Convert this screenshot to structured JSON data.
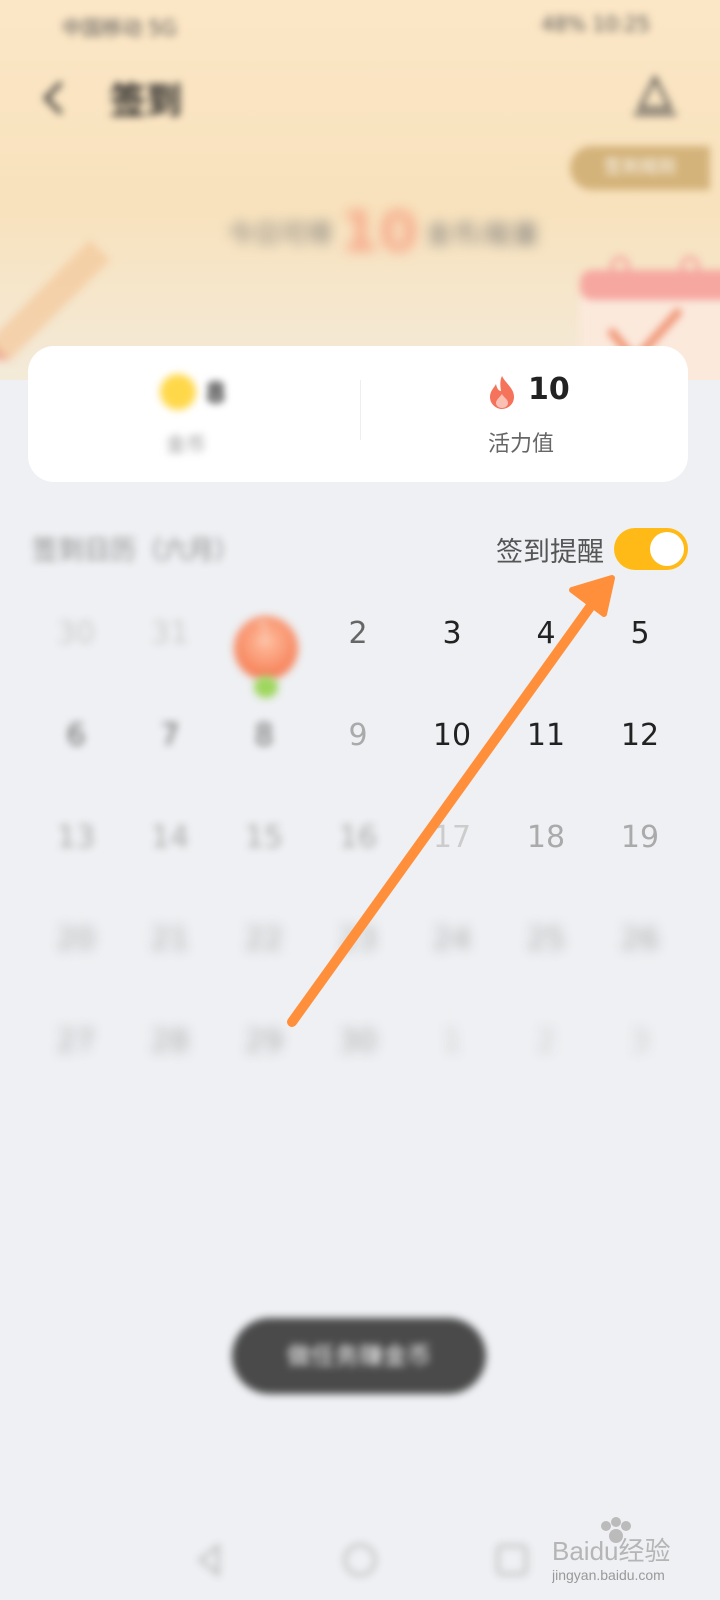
{
  "status_bar": {
    "left_text": "中国移动 5G",
    "right_text": "48% 10:25"
  },
  "header": {
    "title": "签到",
    "rule_button": "签到规则"
  },
  "hero": {
    "prefix": "今日可得",
    "amount": "10",
    "suffix": "金币/能量"
  },
  "stats": {
    "coins_value": "8",
    "coins_label": "金币",
    "vitality_value": "10",
    "vitality_label": "活力值"
  },
  "section": {
    "month_label": "签到日历（六月）",
    "reminder_label": "签到提醒",
    "reminder_on": true
  },
  "calendar": {
    "rows": [
      [
        "30",
        "31",
        "1",
        "2",
        "3",
        "4",
        "5"
      ],
      [
        "6",
        "7",
        "8",
        "9",
        "10",
        "11",
        "12"
      ],
      [
        "13",
        "14",
        "15",
        "16",
        "17",
        "18",
        "19"
      ],
      [
        "20",
        "21",
        "22",
        "23",
        "24",
        "25",
        "26"
      ],
      [
        "27",
        "28",
        "29",
        "30",
        "1",
        "2",
        "3"
      ]
    ]
  },
  "bottom_button": {
    "label": "做任务赚金币"
  },
  "watermark": {
    "text": "Baidu经验",
    "subtext": "jingyan.baidu.com"
  },
  "colors": {
    "accent": "#ffba17",
    "arrow": "#ff8f3a",
    "hero_bg": "#fbe6c6"
  }
}
